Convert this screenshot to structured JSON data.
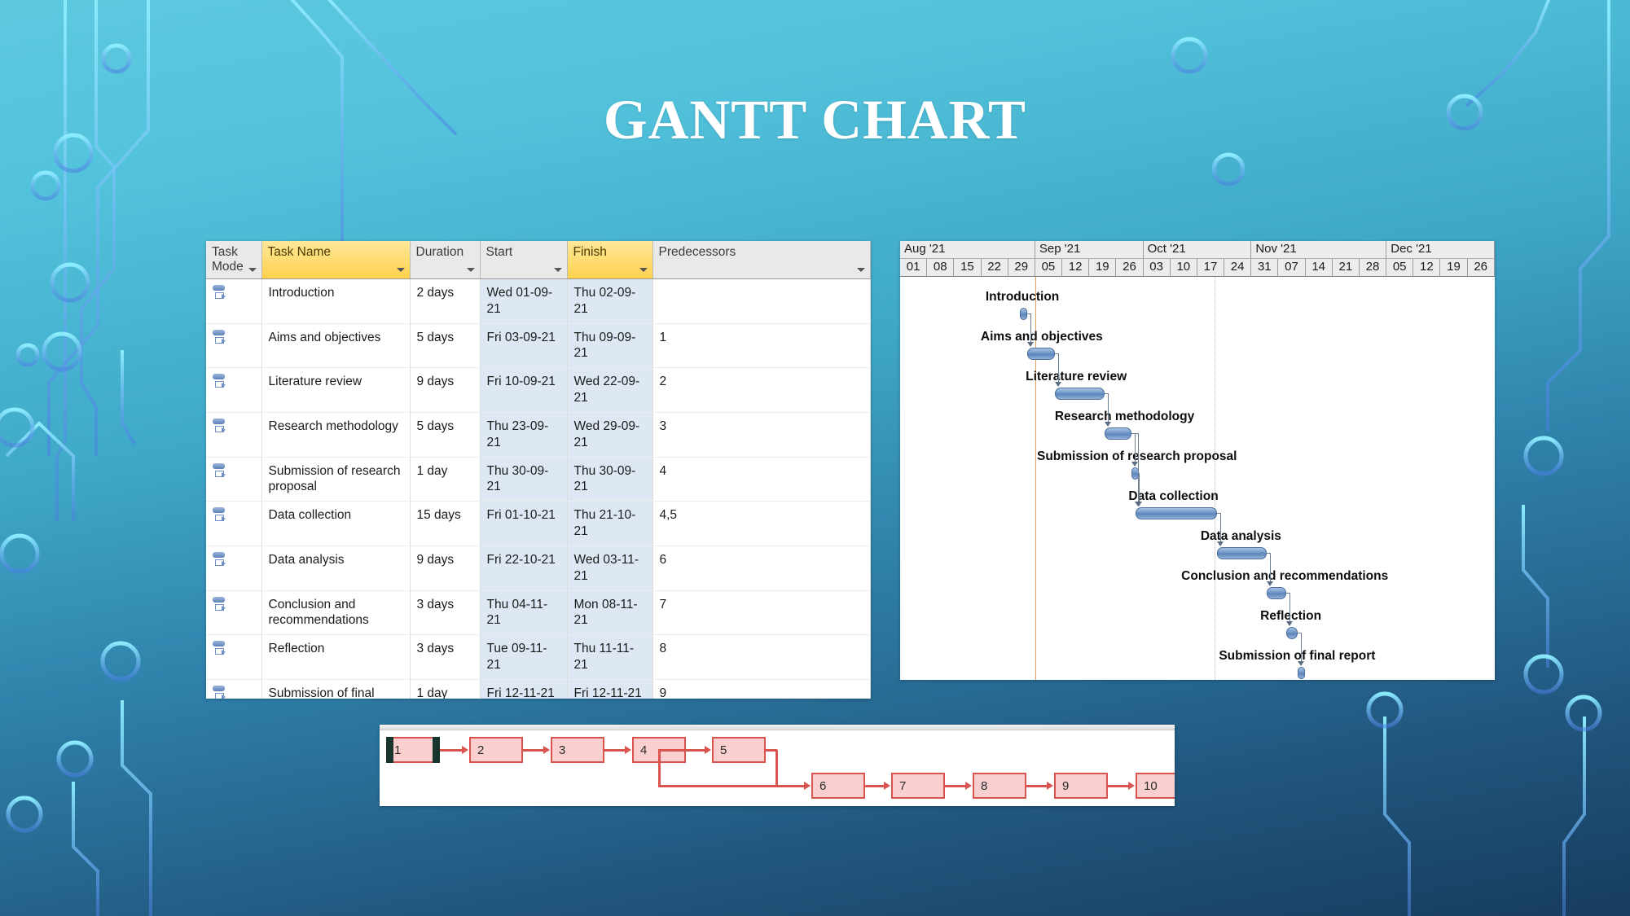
{
  "slide": {
    "title": "GANTT CHART",
    "background": {
      "top_color": "#5ec8de",
      "bottom_color": "#173c5e",
      "accent": "#7fdcf0"
    }
  },
  "table": {
    "columns": [
      {
        "label": "Task Mode",
        "highlight": false
      },
      {
        "label": "Task Name",
        "highlight": true
      },
      {
        "label": "Duration",
        "highlight": false
      },
      {
        "label": "Start",
        "highlight": false
      },
      {
        "label": "Finish",
        "highlight": true
      },
      {
        "label": "Predecessors",
        "highlight": false
      }
    ],
    "rows": [
      {
        "id": 1,
        "mode": "auto-scheduled",
        "name": "Introduction",
        "duration": "2 days",
        "start": "Wed 01-09-21",
        "finish": "Thu 02-09-21",
        "predecessors": ""
      },
      {
        "id": 2,
        "mode": "auto-scheduled",
        "name": "Aims and objectives",
        "duration": "5 days",
        "start": "Fri 03-09-21",
        "finish": "Thu 09-09-21",
        "predecessors": "1"
      },
      {
        "id": 3,
        "mode": "auto-scheduled",
        "name": "Literature review",
        "duration": "9 days",
        "start": "Fri 10-09-21",
        "finish": "Wed 22-09-21",
        "predecessors": "2"
      },
      {
        "id": 4,
        "mode": "auto-scheduled",
        "name": "Research methodology",
        "duration": "5 days",
        "start": "Thu 23-09-21",
        "finish": "Wed 29-09-21",
        "predecessors": "3"
      },
      {
        "id": 5,
        "mode": "auto-scheduled",
        "name": "Submission of research proposal",
        "duration": "1 day",
        "start": "Thu 30-09-21",
        "finish": "Thu 30-09-21",
        "predecessors": "4"
      },
      {
        "id": 6,
        "mode": "auto-scheduled",
        "name": "Data collection",
        "duration": "15 days",
        "start": "Fri 01-10-21",
        "finish": "Thu 21-10-21",
        "predecessors": "4,5"
      },
      {
        "id": 7,
        "mode": "auto-scheduled",
        "name": "Data analysis",
        "duration": "9 days",
        "start": "Fri 22-10-21",
        "finish": "Wed 03-11-21",
        "predecessors": "6"
      },
      {
        "id": 8,
        "mode": "auto-scheduled",
        "name": "Conclusion and recommendations",
        "duration": "3 days",
        "start": "Thu 04-11-21",
        "finish": "Mon 08-11-21",
        "predecessors": "7"
      },
      {
        "id": 9,
        "mode": "auto-scheduled",
        "name": "Reflection",
        "duration": "3 days",
        "start": "Tue 09-11-21",
        "finish": "Thu 11-11-21",
        "predecessors": "8"
      },
      {
        "id": 10,
        "mode": "auto-scheduled",
        "name": "Submission of final report",
        "duration": "1 day",
        "start": "Fri 12-11-21",
        "finish": "Fri 12-11-21",
        "predecessors": "9"
      }
    ]
  },
  "chart_data": {
    "type": "bar",
    "title": "GANTT CHART",
    "xlabel": "",
    "ylabel": "",
    "timeline": {
      "months": [
        "Aug '21",
        "Sep '21",
        "Oct '21",
        "Nov '21",
        "Dec '21"
      ],
      "weeks": [
        "01",
        "08",
        "15",
        "22",
        "29",
        "05",
        "12",
        "19",
        "26",
        "03",
        "10",
        "17",
        "24",
        "31",
        "07",
        "14",
        "21",
        "28",
        "05",
        "12",
        "19",
        "26"
      ],
      "weeks_per_month": [
        5,
        4,
        4,
        5,
        4
      ]
    },
    "categories": [
      "Introduction",
      "Aims and objectives",
      "Literature review",
      "Research methodology",
      "Submission of research proposal",
      "Data collection",
      "Data analysis",
      "Conclusion and recommendations",
      "Reflection",
      "Submission of final report"
    ],
    "values": [
      2,
      5,
      9,
      5,
      1,
      15,
      9,
      3,
      3,
      1
    ],
    "bars": [
      {
        "label": "Introduction",
        "start": "2021-09-01",
        "finish": "2021-09-02",
        "duration_days": 2,
        "predecessors": []
      },
      {
        "label": "Aims and objectives",
        "start": "2021-09-03",
        "finish": "2021-09-09",
        "duration_days": 5,
        "predecessors": [
          1
        ]
      },
      {
        "label": "Literature review",
        "start": "2021-09-10",
        "finish": "2021-09-22",
        "duration_days": 9,
        "predecessors": [
          2
        ]
      },
      {
        "label": "Research methodology",
        "start": "2021-09-23",
        "finish": "2021-09-29",
        "duration_days": 5,
        "predecessors": [
          3
        ]
      },
      {
        "label": "Submission of research proposal",
        "start": "2021-09-30",
        "finish": "2021-09-30",
        "duration_days": 1,
        "predecessors": [
          4
        ]
      },
      {
        "label": "Data collection",
        "start": "2021-10-01",
        "finish": "2021-10-21",
        "duration_days": 15,
        "predecessors": [
          4,
          5
        ]
      },
      {
        "label": "Data analysis",
        "start": "2021-10-22",
        "finish": "2021-11-03",
        "duration_days": 9,
        "predecessors": [
          6
        ]
      },
      {
        "label": "Conclusion and recommendations",
        "start": "2021-11-04",
        "finish": "2021-11-08",
        "duration_days": 3,
        "predecessors": [
          7
        ]
      },
      {
        "label": "Reflection",
        "start": "2021-11-09",
        "finish": "2021-11-11",
        "duration_days": 3,
        "predecessors": [
          8
        ]
      },
      {
        "label": "Submission of final report",
        "start": "2021-11-12",
        "finish": "2021-11-12",
        "duration_days": 1,
        "predecessors": [
          9
        ]
      }
    ],
    "bar_color": "#6e95c6",
    "grid": true,
    "legend": "none"
  },
  "network": {
    "nodes": [
      "1",
      "2",
      "3",
      "4",
      "5",
      "6",
      "7",
      "8",
      "9",
      "10"
    ],
    "selected_node": "1",
    "links": [
      [
        "1",
        "2"
      ],
      [
        "2",
        "3"
      ],
      [
        "3",
        "4"
      ],
      [
        "4",
        "5"
      ],
      [
        "4",
        "6"
      ],
      [
        "5",
        "6"
      ],
      [
        "6",
        "7"
      ],
      [
        "7",
        "8"
      ],
      [
        "8",
        "9"
      ],
      [
        "9",
        "10"
      ]
    ],
    "node_fill": "#f9cfcf",
    "node_border": "#d9534f"
  }
}
